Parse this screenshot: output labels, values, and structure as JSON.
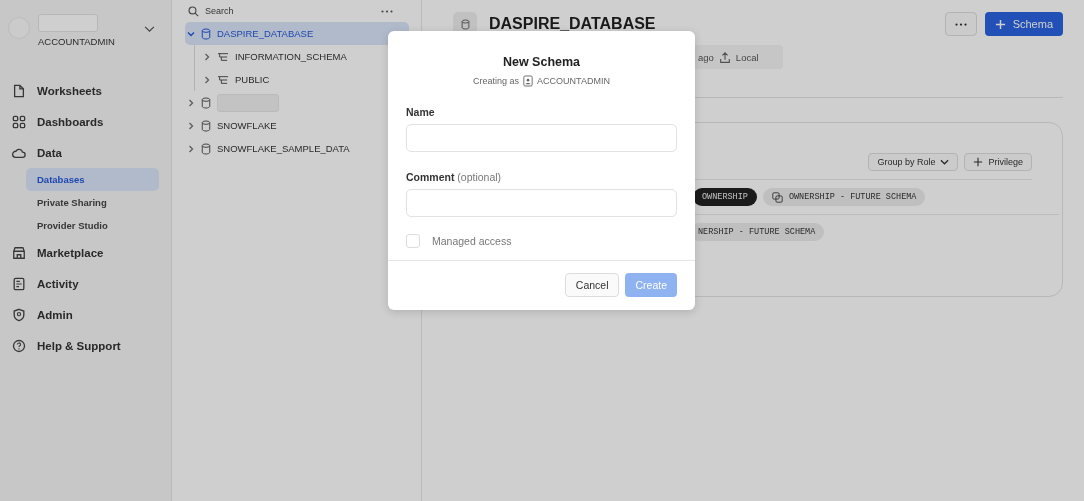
{
  "sidebar": {
    "role": "ACCOUNTADMIN",
    "items": [
      {
        "label": "Worksheets",
        "selected": false
      },
      {
        "label": "Dashboards",
        "selected": false
      },
      {
        "label": "Data",
        "selected": false,
        "children": [
          {
            "label": "Databases",
            "selected": true
          },
          {
            "label": "Private Sharing",
            "selected": false
          },
          {
            "label": "Provider Studio",
            "selected": false
          }
        ]
      },
      {
        "label": "Marketplace",
        "selected": false
      },
      {
        "label": "Activity",
        "selected": false
      },
      {
        "label": "Admin",
        "selected": false
      },
      {
        "label": "Help & Support",
        "selected": false
      }
    ]
  },
  "tree": {
    "search": {
      "placeholder": "Search"
    },
    "items": [
      {
        "kind": "database",
        "label": "DASPIRE_DATABASE",
        "expanded": true,
        "selected": true,
        "children": [
          {
            "kind": "schema",
            "label": "INFORMATION_SCHEMA",
            "expanded": false,
            "selected": false
          },
          {
            "kind": "schema",
            "label": "PUBLIC",
            "expanded": false,
            "selected": false
          }
        ]
      },
      {
        "kind": "redacted",
        "expanded": false,
        "selected": false
      },
      {
        "kind": "database",
        "label": "SNOWFLAKE",
        "expanded": false,
        "selected": false
      },
      {
        "kind": "database",
        "label": "SNOWFLAKE_SAMPLE_DATA",
        "expanded": false,
        "selected": false
      }
    ]
  },
  "main": {
    "title": "DASPIRE_DATABASE",
    "primary_button": "Schema",
    "meta": [
      "ago",
      "Local"
    ],
    "grants": {
      "group_button": "Group by Role",
      "add_button": "Privilege",
      "rows": [
        [
          {
            "label": "OWNERSHIP",
            "selected": true
          },
          {
            "label": "OWNERSHIP - FUTURE SCHEMA",
            "selected": false
          }
        ],
        [
          {
            "label": "NERSHIP - FUTURE SCHEMA",
            "selected": false
          }
        ]
      ]
    }
  },
  "dialog": {
    "title": "New Schema",
    "subtitle": "Creating as",
    "role": "ACCOUNTADMIN",
    "fields": [
      {
        "label": "Name"
      },
      {
        "label": "Comment",
        "hint": "(optional)"
      }
    ],
    "checkbox": {
      "label": "Managed access",
      "checked": false
    },
    "buttons": [
      {
        "label": "Cancel",
        "disabled": false
      },
      {
        "label": "Create",
        "disabled": true
      }
    ]
  }
}
